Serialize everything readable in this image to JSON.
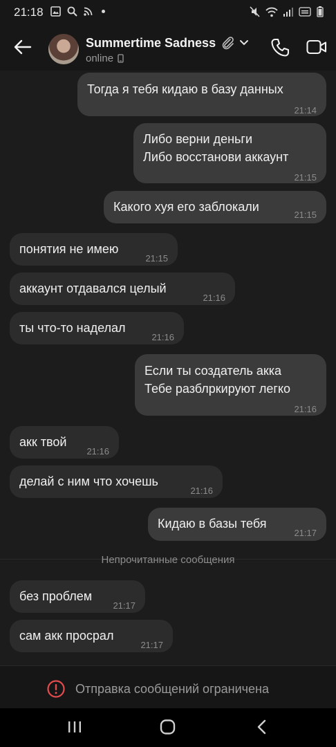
{
  "status_bar": {
    "time": "21:18",
    "left_icons": [
      "gallery-icon",
      "search-icon",
      "rss-icon"
    ],
    "right_icons": [
      "mute-icon",
      "wifi-icon",
      "signal-icon",
      "volte-icon",
      "battery-icon"
    ]
  },
  "header": {
    "contact_name": "Summertime Sadness",
    "status": "online"
  },
  "messages": [
    {
      "dir": "out",
      "text": "Тогда я тебя кидаю в базу данных",
      "time": "21:14"
    },
    {
      "dir": "out",
      "text": "Либо верни деньги\nЛибо восстанови аккаунт",
      "time": "21:15"
    },
    {
      "dir": "out",
      "text": "Какого хуя его заблокали",
      "time": "21:15"
    },
    {
      "dir": "in",
      "text": "понятия не имею",
      "time": "21:15"
    },
    {
      "dir": "in",
      "text": "аккаунт отдавался целый",
      "time": "21:16"
    },
    {
      "dir": "in",
      "text": "ты что-то наделал",
      "time": "21:16"
    },
    {
      "dir": "out",
      "text": "Если ты создатель акка\nТебе разблркируют легко",
      "time": "21:16"
    },
    {
      "dir": "in",
      "text": "акк твой",
      "time": "21:16"
    },
    {
      "dir": "in",
      "text": "делай с ним что хочешь",
      "time": "21:16"
    },
    {
      "dir": "out",
      "text": "Кидаю в базы тебя",
      "time": "21:17"
    },
    {
      "dir": "in",
      "text": "без проблем",
      "time": "21:17"
    },
    {
      "dir": "in",
      "text": "сам акк просрал",
      "time": "21:17"
    }
  ],
  "unread_divider": "Непрочитанные сообщения",
  "restriction_notice": "Отправка сообщений ограничена",
  "colors": {
    "chat_bg": "#1c1c1c",
    "incoming_bubble": "#2c2c2c",
    "outgoing_bubble": "#3b3b3b",
    "warning_red": "#e24c4c"
  }
}
